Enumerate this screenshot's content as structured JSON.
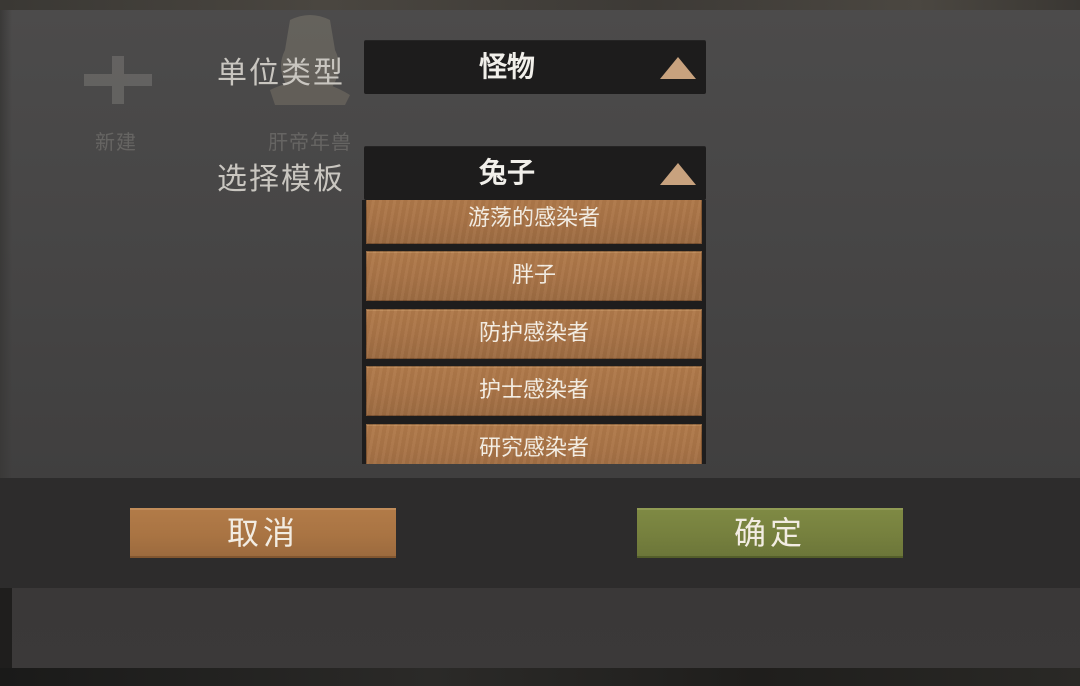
{
  "background": {
    "new_label": "新建",
    "preset_label": "肝帝年兽"
  },
  "form": {
    "unit_type": {
      "label": "单位类型",
      "value": "怪物"
    },
    "template": {
      "label": "选择模板",
      "value": "兔子",
      "options": [
        "游荡的感染者",
        "胖子",
        "防护感染者",
        "护士感染者",
        "研究感染者"
      ]
    }
  },
  "buttons": {
    "cancel": "取消",
    "confirm": "确定"
  },
  "colors": {
    "option_bg": "#a97447",
    "cancel_bg": "#a97443",
    "confirm_bg": "#76803e",
    "dropdown_bg": "#1d1c1c",
    "arrow": "#c8a27e"
  },
  "icons": {
    "add": "plus-icon",
    "dropdown_arrow": "triangle-up-icon"
  }
}
